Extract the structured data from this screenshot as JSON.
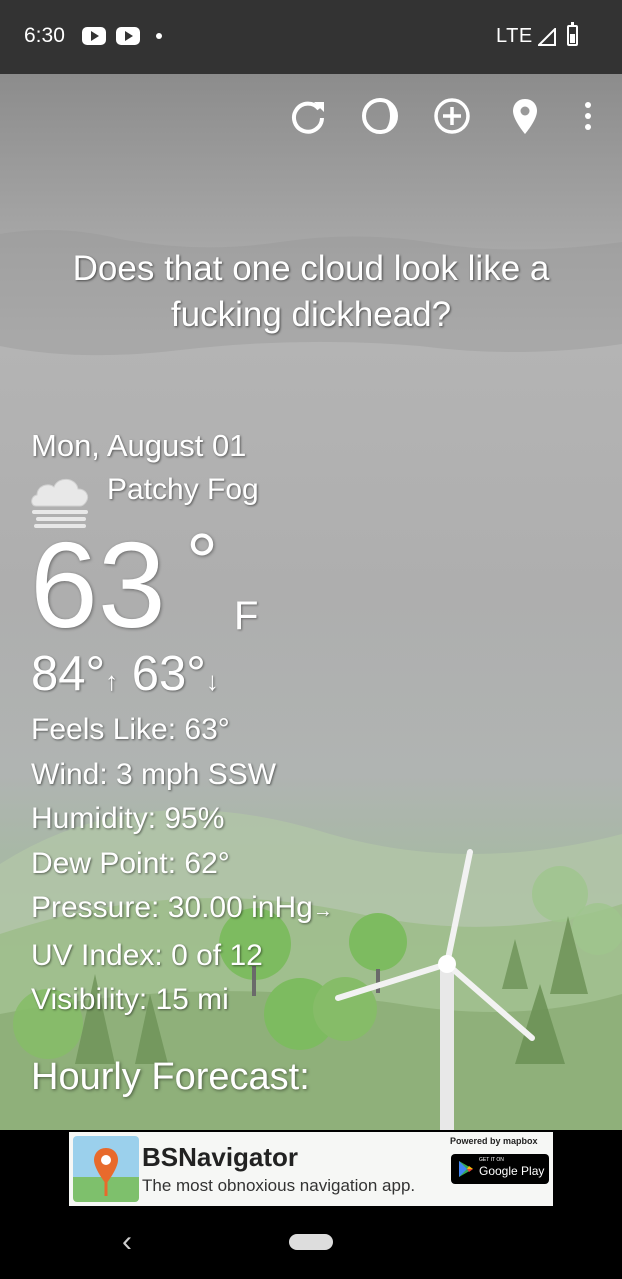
{
  "status_bar": {
    "time": "6:30",
    "network": "LTE"
  },
  "toolbar": {
    "icons": [
      "refresh-icon",
      "theme-icon",
      "add-location-icon",
      "location-pin-icon",
      "more-vert-icon"
    ]
  },
  "headline": "Does that one cloud look like a fucking dickhead?",
  "current": {
    "date": "Mon, August 01",
    "condition": "Patchy Fog",
    "condition_icon": "fog-cloud-icon",
    "temperature": "63",
    "degree_symbol": "°",
    "unit": "F",
    "high": "84°",
    "high_arrow": "↑",
    "low": "63°",
    "low_arrow": "↓"
  },
  "details": {
    "feels_like": "Feels Like:  63°",
    "wind": "Wind:  3 mph SSW",
    "humidity": "Humidity:  95%",
    "dew_point": "Dew Point:  62°",
    "pressure": "Pressure:  30.00 inHg",
    "pressure_arrow": "→",
    "uv_index": "UV Index:  0 of 12",
    "visibility": "Visibility:  15 mi"
  },
  "hourly_heading": "Hourly Forecast:",
  "ad": {
    "title": "BSNavigator",
    "subtitle": "The most obnoxious navigation app.",
    "powered_by": "Powered by mapbox",
    "store_small": "GET IT ON",
    "store_label": "Google Play"
  },
  "colors": {
    "status_bar": "#333333",
    "sky": "#a7a7a7",
    "text": "#ffffff",
    "hill": "#8fb07a",
    "tree": "#7dbb60"
  }
}
